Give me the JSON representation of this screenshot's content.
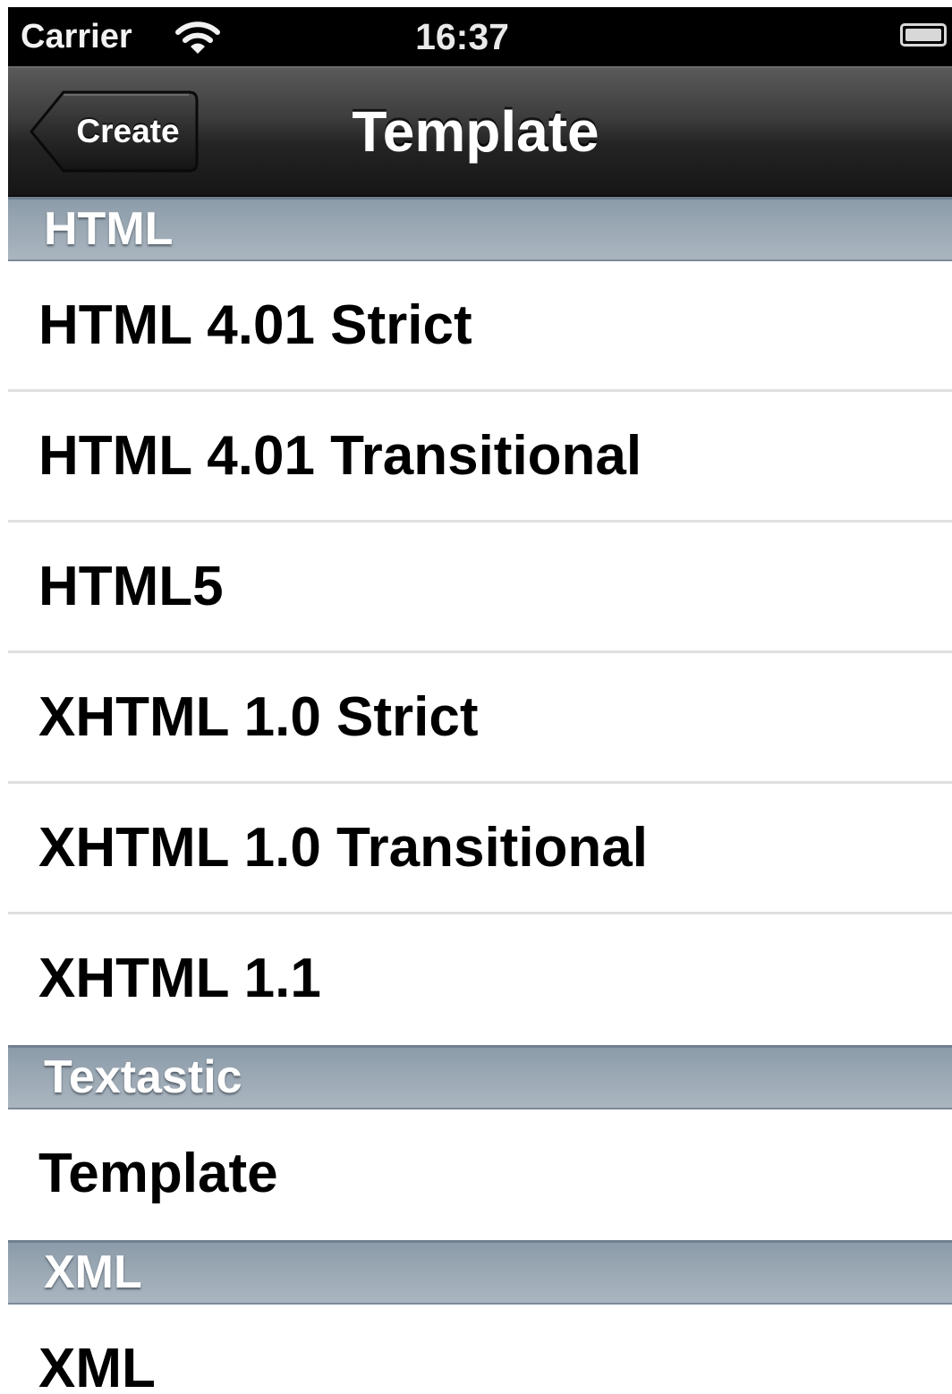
{
  "status_bar": {
    "carrier": "Carrier",
    "time": "16:37"
  },
  "nav": {
    "back_label": "Create",
    "title": "Template"
  },
  "sections": [
    {
      "header": "HTML",
      "rows": [
        "HTML 4.01 Strict",
        "HTML 4.01 Transitional",
        "HTML5",
        "XHTML 1.0 Strict",
        "XHTML 1.0 Transitional",
        "XHTML 1.1"
      ]
    },
    {
      "header": "Textastic",
      "rows": [
        "Template"
      ]
    },
    {
      "header": "XML",
      "rows": [
        "XML"
      ]
    }
  ],
  "icons": {
    "wifi": "wifi-icon",
    "battery": "battery-icon"
  }
}
